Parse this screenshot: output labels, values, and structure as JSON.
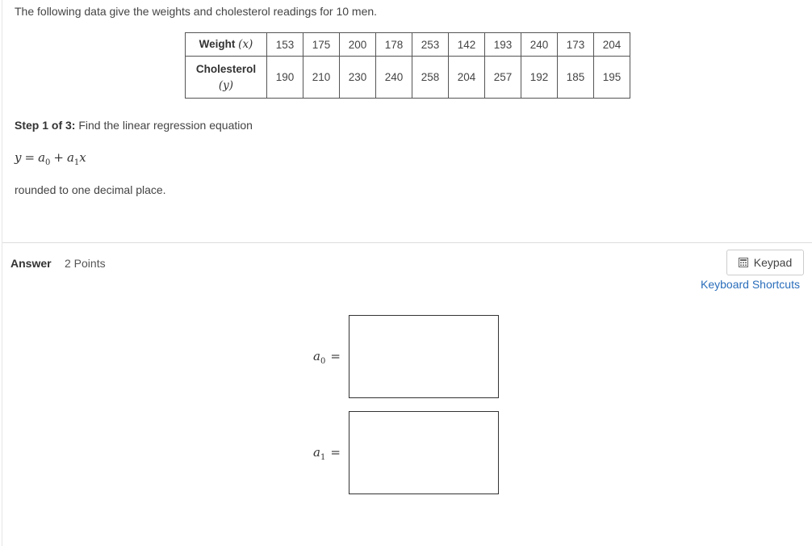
{
  "question": "The following data give the weights and cholesterol readings for 10 men.",
  "table": {
    "row1_label": "Weight",
    "row1_var": "(x)",
    "row2_label": "Cholesterol",
    "row2_var": "(y)",
    "weights": [
      "153",
      "175",
      "200",
      "178",
      "253",
      "142",
      "193",
      "240",
      "173",
      "204"
    ],
    "cholesterol": [
      "190",
      "210",
      "230",
      "240",
      "258",
      "204",
      "257",
      "192",
      "185",
      "195"
    ]
  },
  "step": {
    "prefix": "Step 1 of 3:",
    "text": "Find the linear regression equation"
  },
  "equation": {
    "y": "y",
    "eq": "=",
    "a": "a",
    "sub0": "0",
    "plus": "+",
    "sub1": "1",
    "x": "x"
  },
  "rounding_note": "rounded to one decimal place.",
  "answer": {
    "label": "Answer",
    "points": "2 Points",
    "keypad_label": "Keypad",
    "keypad_icon": "calculator-icon",
    "shortcuts_label": "Keyboard Shortcuts",
    "fields": [
      {
        "var": "a",
        "sub": "0",
        "eq": "=",
        "value": ""
      },
      {
        "var": "a",
        "sub": "1",
        "eq": "=",
        "value": ""
      }
    ]
  },
  "colors": {
    "link": "#2a6ebb",
    "text": "#444444",
    "border": "#555555"
  }
}
